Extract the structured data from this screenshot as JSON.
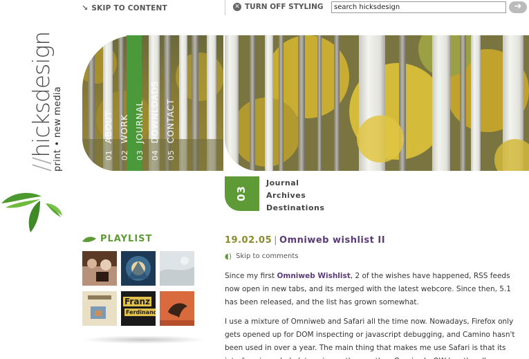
{
  "topbar": {
    "skip_to_content": "SKIP TO CONTENT",
    "turn_off_styling": "TURN OFF STYLING",
    "search_value": "search hicksdesign",
    "search_button": "➜"
  },
  "logo": {
    "slashes": "//",
    "name": "hicksdesign",
    "tagline": "print • new media"
  },
  "nav": {
    "items": [
      {
        "num": "01",
        "label": "ABOUT"
      },
      {
        "num": "02",
        "label": "WORK"
      },
      {
        "num": "03",
        "label": "JOURNAL"
      },
      {
        "num": "04",
        "label": "DOWNLOADS"
      },
      {
        "num": "05",
        "label": "CONTACT"
      }
    ],
    "active_index": 2
  },
  "section": {
    "number": "03",
    "subnav": [
      "Journal",
      "Archives",
      "Destinations"
    ]
  },
  "playlist": {
    "title": "PLAYLIST",
    "album_text": {
      "franz": "Franz",
      "ferdinand": "Ferdinand"
    }
  },
  "post": {
    "date": "19.02.05",
    "separator": "|",
    "title": "Omniweb wishlist II",
    "skip_comments": "Skip to comments",
    "p1_before": "Since my first ",
    "p1_link": "Omniweb Wishlist",
    "p1_after": ", 2 of the wishes have happened, RSS feeds now open in new tabs, and its merged with the latest webcore. Since then, 5.1 has been released, and the list has grown somewhat.",
    "p2": "I use a mixture of Omniweb and Safari all the time now. Nowadays, Firefox only gets opened up for DOM inspecting or javascript debugging, and Camino hasn't been used in over a year. The main thing that makes me use Safari is that its interface is a whole lot easier on the eye than Omniweb. OW has the all"
  },
  "colors": {
    "accent_green": "#5e9a36",
    "nav_active": "#4a9a3c",
    "title_purple": "#5a3b78",
    "date_olive": "#8a8a2e"
  }
}
